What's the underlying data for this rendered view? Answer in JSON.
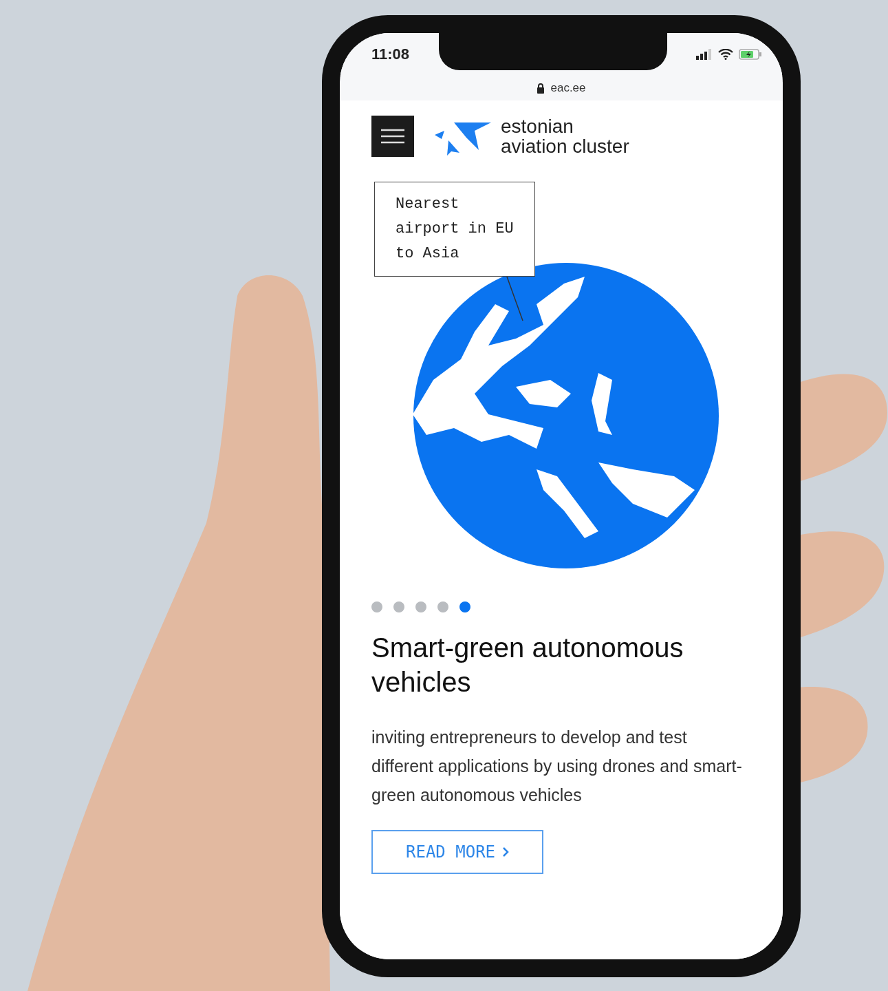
{
  "status_bar": {
    "time": "11:08"
  },
  "address_bar": {
    "url": "eac.ee"
  },
  "header": {
    "logo_lines": [
      "estonian",
      "aviation cluster"
    ]
  },
  "callout": {
    "text": "Nearest airport in EU to Asia"
  },
  "carousel": {
    "dots": [
      {
        "selected": false
      },
      {
        "selected": false
      },
      {
        "selected": false
      },
      {
        "selected": false
      },
      {
        "selected": true
      }
    ]
  },
  "slide": {
    "title": "Smart-green autonomous vehicles",
    "body": "inviting entrepreneurs to develop and test different applications by using drones and smart-green autonomous vehicles",
    "button": "READ MORE"
  }
}
